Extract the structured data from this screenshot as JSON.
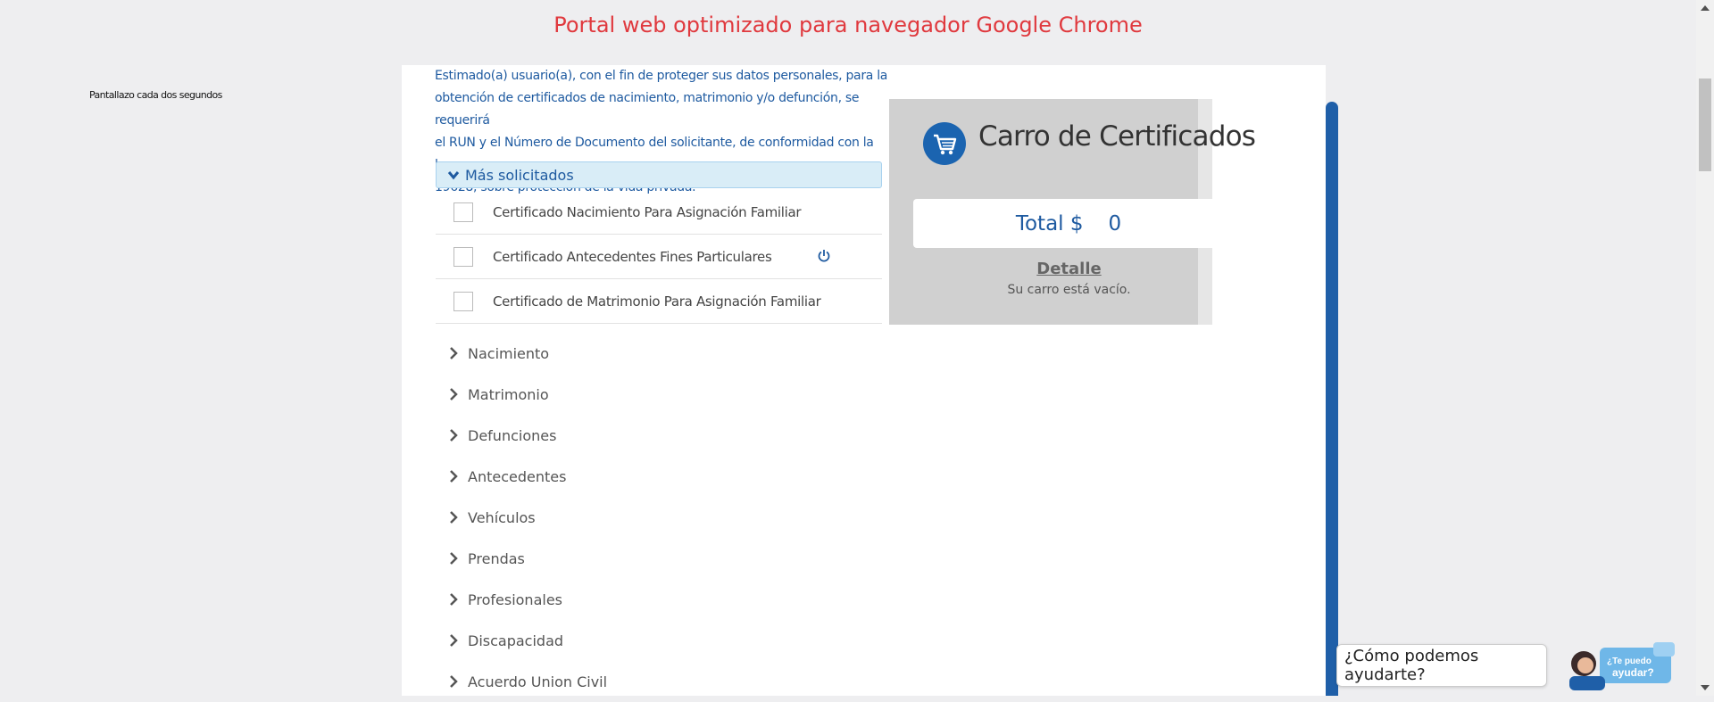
{
  "banner": "Portal web optimizado para navegador Google Chrome",
  "side_note": "Pantallazo cada dos segundos",
  "notice_lines": [
    "Estimado(a) usuario(a), con el fin de proteger sus datos personales, para la",
    "obtención de certificados de nacimiento, matrimonio y/o defunción, se requerirá",
    "el RUN y el Número de Documento del solicitante, de conformidad con la ley",
    "19628, sobre protección de la vida privada."
  ],
  "most_requested": {
    "header": "Más solicitados",
    "items": [
      {
        "label": "Certificado Nacimiento Para Asignación Familiar",
        "checked": false,
        "power_icon": false
      },
      {
        "label": "Certificado Antecedentes Fines Particulares",
        "checked": false,
        "power_icon": true
      },
      {
        "label": "Certificado de Matrimonio Para Asignación Familiar",
        "checked": false,
        "power_icon": false
      }
    ]
  },
  "categories": [
    "Nacimiento",
    "Matrimonio",
    "Defunciones",
    "Antecedentes",
    "Vehículos",
    "Prendas",
    "Profesionales",
    "Discapacidad",
    "Acuerdo Union Civil"
  ],
  "cart": {
    "title": "Carro de Certificados",
    "total_label": "Total $",
    "total_value": "0",
    "detail_link": "Detalle",
    "empty_text": "Su carro está vacío.",
    "icon": "shopping-cart-icon"
  },
  "chat": {
    "prompt": "¿Cómo podemos ayudarte?",
    "avatar_text_1": "¿Te puedo",
    "avatar_text_2": "ayudar?"
  },
  "colors": {
    "banner": "#e0393e",
    "primary_blue": "#1e5aa0",
    "cart_bg": "#d0d0d0",
    "accent_bar": "#1f5fa8"
  }
}
